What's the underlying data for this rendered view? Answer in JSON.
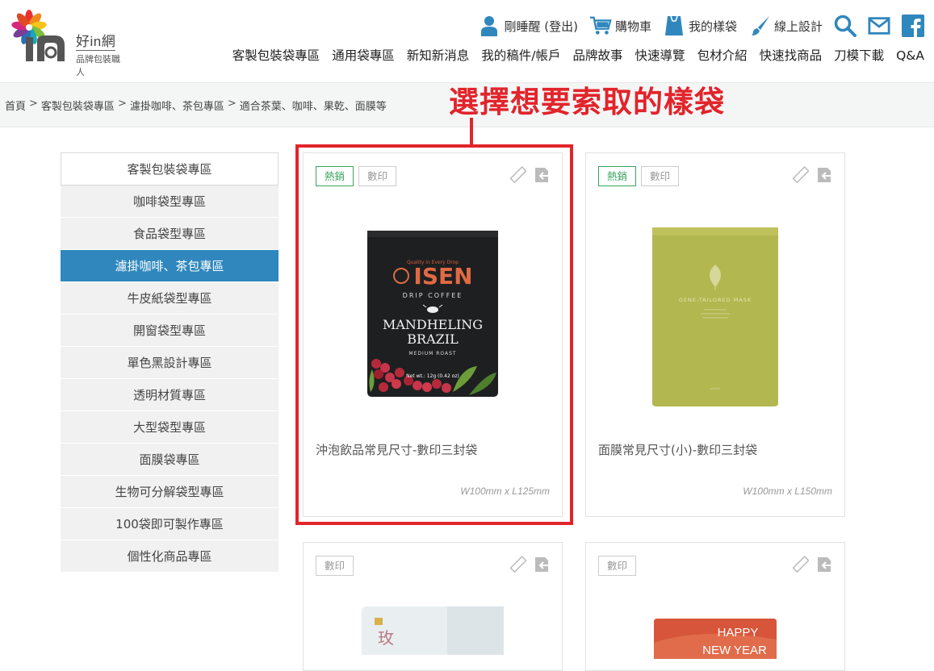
{
  "brand": {
    "name": "好in網",
    "tagline": "品牌包裝職人"
  },
  "topbar": {
    "user": "剛睡醒 (登出)",
    "cart": "購物車",
    "samples": "我的樣袋",
    "design": "線上設計"
  },
  "nav": [
    "客製包裝袋專區",
    "通用袋專區",
    "新知新消息",
    "我的稿件/帳戶",
    "品牌故事",
    "快速導覽",
    "包材介紹",
    "快速找商品",
    "刀模下載",
    "Q&A"
  ],
  "breadcrumb": [
    "首頁",
    "客製包裝袋專區",
    "濾掛咖啡、茶包專區",
    "適合茶葉、咖啡、果乾、面膜等"
  ],
  "annotation": "選擇想要索取的樣袋",
  "sidebar": [
    "客製包裝袋專區",
    "咖啡袋型專區",
    "食品袋型專區",
    "濾掛咖啡、茶包專區",
    "牛皮紙袋型專區",
    "開窗袋型專區",
    "單色黑設計專區",
    "透明材質專區",
    "大型袋型專區",
    "面膜袋專區",
    "生物可分解袋型專區",
    "100袋即可製作專區",
    "個性化商品專區"
  ],
  "products": [
    {
      "tags": [
        "熱銷",
        "數印"
      ],
      "title": "沖泡飲品常見尺寸-數印三封袋",
      "size": "W100mm x L125mm",
      "pack": {
        "quality": "Quality in Every Drop",
        "brand": "ISEN",
        "line": "DRIP COFFEE",
        "name1": "MANDHELING",
        "name2": "BRAZIL",
        "roast": "MEDIUM ROAST",
        "weight": "Net wt.: 12g (0.42 oz)"
      }
    },
    {
      "tags": [
        "熱銷",
        "數印"
      ],
      "title": "面膜常見尺寸(小)-數印三封袋",
      "size": "W100mm x L150mm",
      "pack": {
        "name": "GENE-TAILORED MASK"
      }
    },
    {
      "tags": [
        "數印"
      ],
      "pack": {
        "text": "玫"
      }
    },
    {
      "tags": [
        "數印"
      ],
      "pack": {
        "line1": "HAPPY",
        "line2": "NEW YEAR"
      }
    }
  ],
  "colors": {
    "accent_red": "#e2242b",
    "active_blue": "#2f87bd",
    "hot_green": "#39a45d",
    "icon_blue": "#2f87bd"
  }
}
